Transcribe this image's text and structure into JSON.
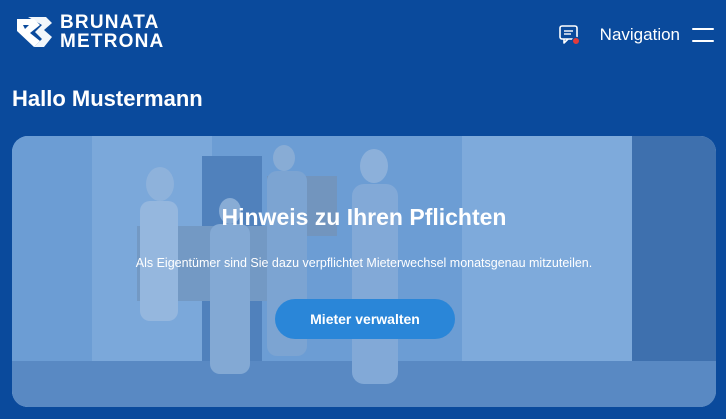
{
  "brand": {
    "line1": "BRUNATA",
    "line2": "METRONA"
  },
  "header": {
    "nav_label": "Navigation",
    "icons": [
      "message-icon",
      "menu-icon"
    ],
    "notification_color": "#e23b3b"
  },
  "greeting": "Hallo Mustermann",
  "hero": {
    "title": "Hinweis zu Ihren Pflichten",
    "text": "Als Eigentümer sind Sie dazu verpflichtet Mieterwechsel monatsgenau mitzuteilen.",
    "button_label": "Mieter verwalten"
  },
  "colors": {
    "background": "#0a4a9c",
    "button": "#2a86d8"
  }
}
